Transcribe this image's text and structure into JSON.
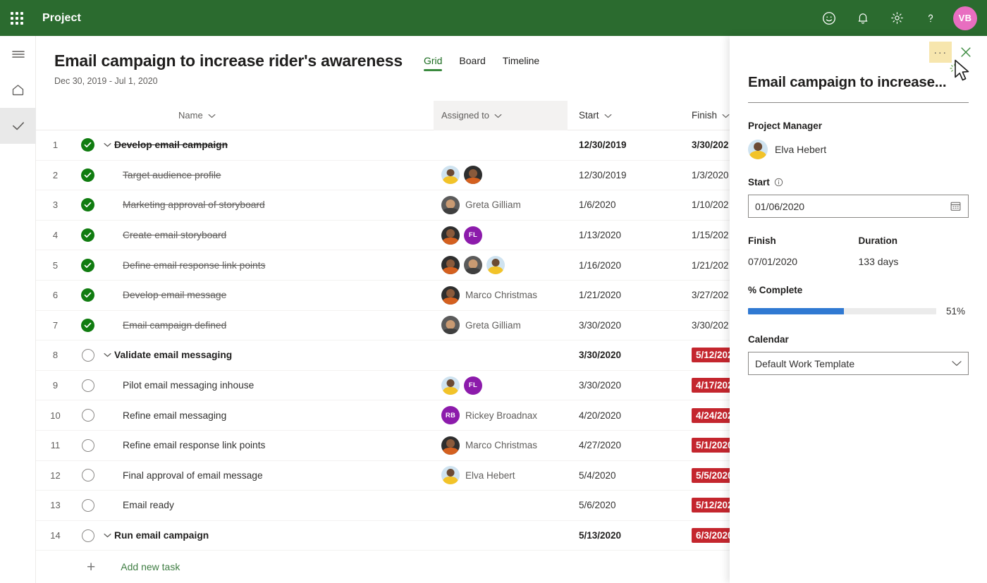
{
  "suite": {
    "app_title": "Project",
    "waffle_label": "app-launcher",
    "icons": [
      "smiley-icon",
      "bell-icon",
      "gear-icon",
      "help-icon"
    ],
    "avatar_initials": "VB",
    "avatar_color": "#e86ec0",
    "bar_color": "#2b6b2f"
  },
  "rail": {
    "items": [
      {
        "icon": "hamburger-icon",
        "selected": false
      },
      {
        "icon": "home-icon",
        "selected": false
      },
      {
        "icon": "check-icon",
        "selected": true
      }
    ]
  },
  "page": {
    "title": "Email campaign to increase rider's awareness",
    "date_range": "Dec 30, 2019 - Jul 1, 2020",
    "tabs": [
      {
        "label": "Grid",
        "active": true
      },
      {
        "label": "Board",
        "active": false
      },
      {
        "label": "Timeline",
        "active": false
      }
    ]
  },
  "table": {
    "columns": [
      {
        "key": "name",
        "label": "Name"
      },
      {
        "key": "assigned_to",
        "label": "Assigned to"
      },
      {
        "key": "start",
        "label": "Start"
      },
      {
        "key": "finish",
        "label": "Finish"
      }
    ],
    "add_row_label": "Add new task",
    "rows": [
      {
        "num": "1",
        "done": true,
        "summary": true,
        "name": "Develop email campaign",
        "assignees": [],
        "assignee_label": "",
        "start": "12/30/2019",
        "start_bold": true,
        "finish": "3/30/202",
        "finish_late": false,
        "finish_bold": true
      },
      {
        "num": "2",
        "done": true,
        "summary": false,
        "name": "Target audience profile",
        "assignees": [
          "elva",
          "marco"
        ],
        "assignee_label": "",
        "start": "12/30/2019",
        "start_bold": false,
        "finish": "1/3/2020",
        "finish_late": false,
        "finish_bold": false
      },
      {
        "num": "3",
        "done": true,
        "summary": false,
        "name": "Marketing approval of storyboard",
        "assignees": [
          "greta"
        ],
        "assignee_label": "Greta Gilliam",
        "start": "1/6/2020",
        "start_bold": false,
        "finish": "1/10/202",
        "finish_late": false,
        "finish_bold": false
      },
      {
        "num": "4",
        "done": true,
        "summary": false,
        "name": "Create email storyboard",
        "assignees": [
          "marco",
          "fl"
        ],
        "assignee_label": "",
        "start": "1/13/2020",
        "start_bold": false,
        "finish": "1/15/202",
        "finish_late": false,
        "finish_bold": false
      },
      {
        "num": "5",
        "done": true,
        "summary": false,
        "name": "Define email response link points",
        "assignees": [
          "marco",
          "greta",
          "elva"
        ],
        "assignee_label": "",
        "start": "1/16/2020",
        "start_bold": false,
        "finish": "1/21/202",
        "finish_late": false,
        "finish_bold": false
      },
      {
        "num": "6",
        "done": true,
        "summary": false,
        "name": "Develop email message",
        "assignees": [
          "marco"
        ],
        "assignee_label": "Marco Christmas",
        "start": "1/21/2020",
        "start_bold": false,
        "finish": "3/27/202",
        "finish_late": false,
        "finish_bold": false
      },
      {
        "num": "7",
        "done": true,
        "summary": false,
        "name": "Email campaign defined",
        "assignees": [
          "greta"
        ],
        "assignee_label": "Greta Gilliam",
        "start": "3/30/2020",
        "start_bold": false,
        "finish": "3/30/202",
        "finish_late": false,
        "finish_bold": false
      },
      {
        "num": "8",
        "done": false,
        "summary": true,
        "name": "Validate email messaging",
        "assignees": [],
        "assignee_label": "",
        "start": "3/30/2020",
        "start_bold": true,
        "finish": "5/12/202",
        "finish_late": true,
        "finish_bold": true
      },
      {
        "num": "9",
        "done": false,
        "summary": false,
        "name": "Pilot email messaging inhouse",
        "assignees": [
          "elva",
          "fl"
        ],
        "assignee_label": "",
        "start": "3/30/2020",
        "start_bold": false,
        "finish": "4/17/202",
        "finish_late": true,
        "finish_bold": false
      },
      {
        "num": "10",
        "done": false,
        "summary": false,
        "name": "Refine email messaging",
        "assignees": [
          "rb"
        ],
        "assignee_label": "Rickey Broadnax",
        "start": "4/20/2020",
        "start_bold": false,
        "finish": "4/24/202",
        "finish_late": true,
        "finish_bold": false
      },
      {
        "num": "11",
        "done": false,
        "summary": false,
        "name": "Refine email response link points",
        "assignees": [
          "marco"
        ],
        "assignee_label": "Marco Christmas",
        "start": "4/27/2020",
        "start_bold": false,
        "finish": "5/1/2020",
        "finish_late": true,
        "finish_bold": false
      },
      {
        "num": "12",
        "done": false,
        "summary": false,
        "name": "Final approval of email message",
        "assignees": [
          "elva"
        ],
        "assignee_label": "Elva Hebert",
        "start": "5/4/2020",
        "start_bold": false,
        "finish": "5/5/2020",
        "finish_late": true,
        "finish_bold": false
      },
      {
        "num": "13",
        "done": false,
        "summary": false,
        "name": "Email ready",
        "assignees": [],
        "assignee_label": "",
        "start": "5/6/2020",
        "start_bold": false,
        "finish": "5/12/202",
        "finish_late": true,
        "finish_bold": false
      },
      {
        "num": "14",
        "done": false,
        "summary": true,
        "name": "Run email campaign",
        "assignees": [],
        "assignee_label": "",
        "start": "5/13/2020",
        "start_bold": true,
        "finish": "6/3/2020",
        "finish_late": true,
        "finish_bold": true
      }
    ]
  },
  "panel": {
    "ellipsis_label": "···",
    "close_label": "close-icon",
    "title": "Email campaign to increase...",
    "project_manager_label": "Project Manager",
    "project_manager_name": "Elva Hebert",
    "start_label": "Start",
    "start_value": "01/06/2020",
    "finish_label": "Finish",
    "finish_value": "07/01/2020",
    "duration_label": "Duration",
    "duration_value": "133 days",
    "percent_complete_label": "% Complete",
    "percent_complete_value": "51%",
    "percent_complete_number": 51,
    "progress_color": "#3079d2",
    "calendar_label": "Calendar",
    "calendar_value": "Default Work Template"
  },
  "colors": {
    "accent_green": "#2b6b2f",
    "tab_underline": "#3a8a3e",
    "late_red": "#c4262e",
    "done_green": "#107c10",
    "highlight_yellow": "#f7e6ae"
  }
}
